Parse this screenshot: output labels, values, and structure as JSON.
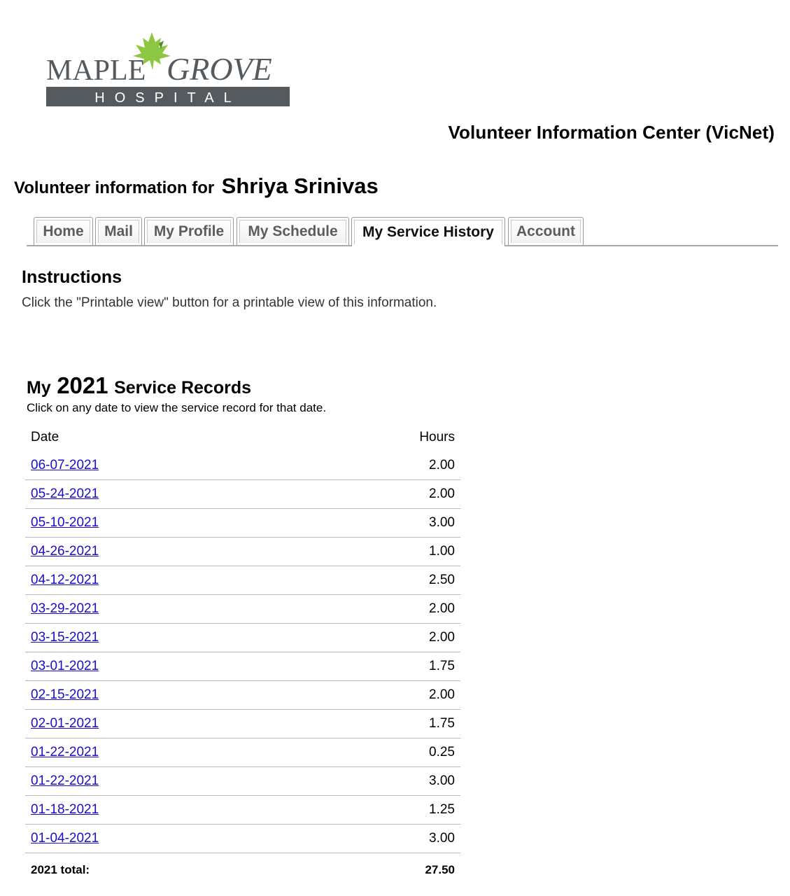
{
  "logo": {
    "line1_a": "MAPLE",
    "line1_b": "GROVE",
    "line2": "HOSPITAL",
    "leaf_color": "#8dc641",
    "text_color": "#555a5e"
  },
  "site_title": "Volunteer Information Center (VicNet)",
  "volunteer": {
    "prefix": "Volunteer information for",
    "name": "Shriya Srinivas"
  },
  "tabs": [
    {
      "label": "Home",
      "active": false
    },
    {
      "label": "Mail",
      "active": false
    },
    {
      "label": "My Profile",
      "active": false
    },
    {
      "label": "My Schedule",
      "active": false
    },
    {
      "label": "My Service History",
      "active": true
    },
    {
      "label": "Account",
      "active": false
    }
  ],
  "instructions": {
    "title": "Instructions",
    "text": "Click the \"Printable view\" button for a printable view of this information."
  },
  "records": {
    "title_prefix": "My",
    "year": "2021",
    "title_suffix": "Service Records",
    "subtitle": "Click on any date to view the service record for that date.",
    "columns": {
      "date": "Date",
      "hours": "Hours"
    },
    "rows": [
      {
        "date": "06-07-2021",
        "hours": "2.00"
      },
      {
        "date": "05-24-2021",
        "hours": "2.00"
      },
      {
        "date": "05-10-2021",
        "hours": "3.00"
      },
      {
        "date": "04-26-2021",
        "hours": "1.00"
      },
      {
        "date": "04-12-2021",
        "hours": "2.50"
      },
      {
        "date": "03-29-2021",
        "hours": "2.00"
      },
      {
        "date": "03-15-2021",
        "hours": "2.00"
      },
      {
        "date": "03-01-2021",
        "hours": "1.75"
      },
      {
        "date": "02-15-2021",
        "hours": "2.00"
      },
      {
        "date": "02-01-2021",
        "hours": "1.75"
      },
      {
        "date": "01-22-2021",
        "hours": "0.25"
      },
      {
        "date": "01-22-2021",
        "hours": "3.00"
      },
      {
        "date": "01-18-2021",
        "hours": "1.25"
      },
      {
        "date": "01-04-2021",
        "hours": "3.00"
      }
    ],
    "total_label": "2021 total:",
    "total_value": "27.50"
  },
  "colors": {
    "link": "#1a0dcc",
    "tab_border": "#9a9a9a"
  }
}
